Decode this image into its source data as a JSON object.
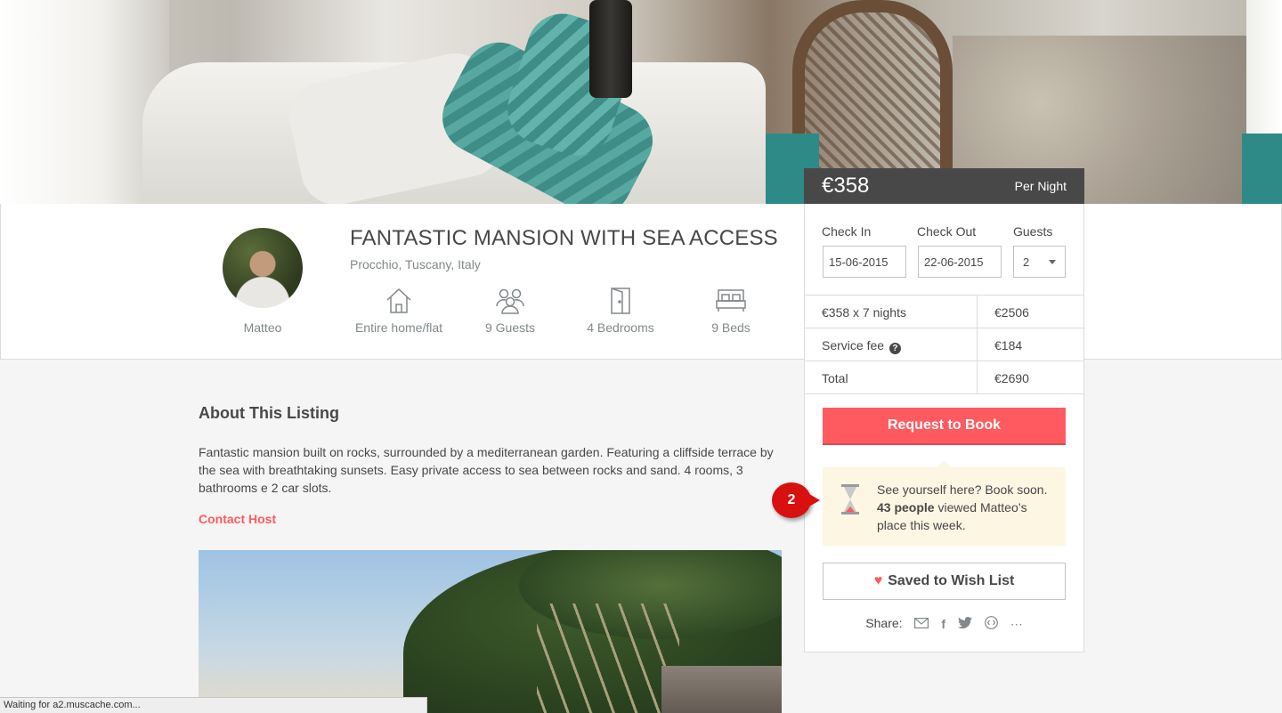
{
  "listing": {
    "title": "FANTASTIC MANSION WITH SEA ACCESS",
    "location": "Procchio, Tuscany, Italy",
    "host_name": "Matteo"
  },
  "amenities": [
    {
      "label": "Entire home/flat",
      "icon": "house-icon"
    },
    {
      "label": "9 Guests",
      "icon": "guests-icon"
    },
    {
      "label": "4 Bedrooms",
      "icon": "door-icon"
    },
    {
      "label": "9 Beds",
      "icon": "bed-icon"
    }
  ],
  "booking": {
    "price": "€358",
    "per": "Per Night",
    "check_in_label": "Check In",
    "check_out_label": "Check Out",
    "guests_label": "Guests",
    "check_in_value": "15-06-2015",
    "check_out_value": "22-06-2015",
    "guests_value": "2",
    "lines": [
      {
        "label": "€358 x 7 nights",
        "value": "€2506"
      },
      {
        "label": "Service fee",
        "value": "€184"
      },
      {
        "label": "Total",
        "value": "€2690"
      }
    ],
    "help_glyph": "?",
    "request_label": "Request to Book",
    "urgency_line1": "See yourself here? Book soon.",
    "urgency_bold": "43 people",
    "urgency_rest": " viewed Matteo’s place this week.",
    "wish_label": "Saved to Wish List",
    "share_label": "Share:",
    "accent_color": "#ff5a5f"
  },
  "annotation": {
    "badge": "2"
  },
  "about": {
    "heading": "About This Listing",
    "body": "Fantastic mansion built on rocks, surrounded by a mediterranean garden. Featuring a cliffside terrace by the sea with breathtaking sunsets. Easy private access to sea between rocks and sand. 4 rooms, 3 bathrooms e 2 car slots.",
    "contact_label": "Contact Host"
  },
  "statusbar": {
    "text": "Waiting for a2.muscache.com..."
  }
}
